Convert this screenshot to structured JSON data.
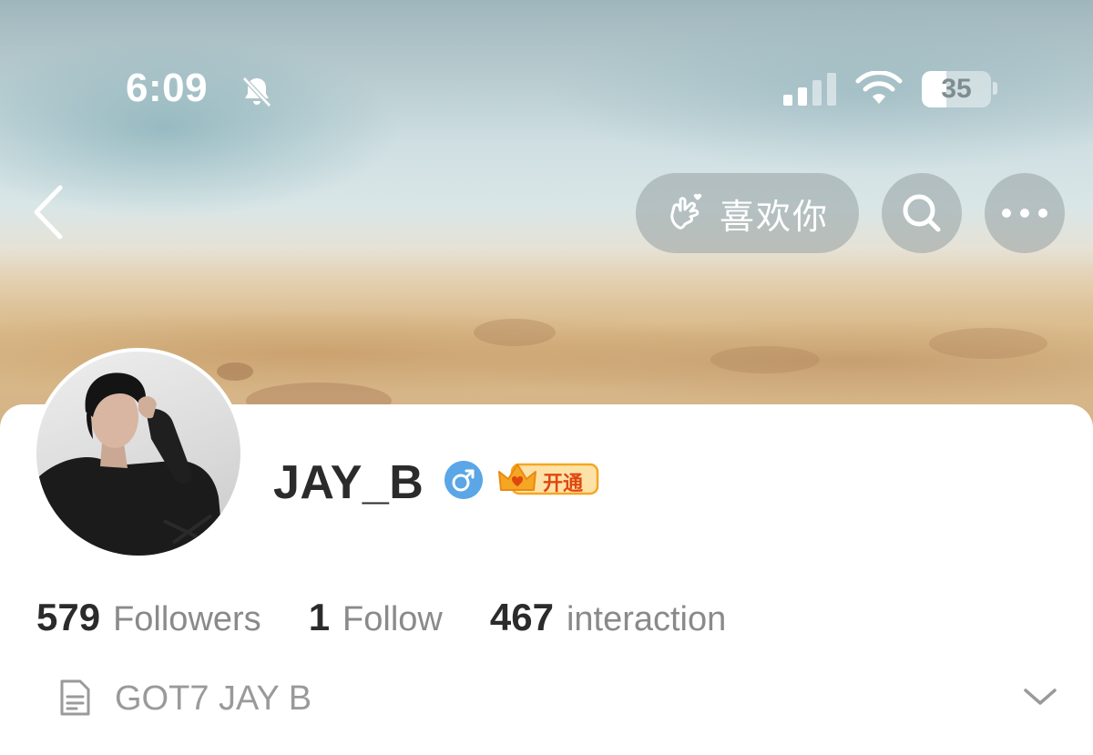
{
  "status_bar": {
    "time": "6:09",
    "battery_level": "35",
    "battery_fraction": 0.35,
    "icons": [
      "bell-slash-icon",
      "cellular-signal-icon",
      "wifi-icon",
      "battery-icon"
    ]
  },
  "nav": {
    "back_icon": "chevron-left-icon",
    "like_button_label": "喜欢你",
    "like_icon": "finger-heart-hand-icon",
    "search_icon": "search-icon",
    "more_icon": "more-horizontal-icon"
  },
  "profile": {
    "username": "JAY_B",
    "gender_icon": "male-symbol-icon",
    "vip_badge_label": "开通",
    "vip_icon": "crown-icon",
    "stats": [
      {
        "value": "579",
        "label": "Followers"
      },
      {
        "value": "1",
        "label": "Follow"
      },
      {
        "value": "467",
        "label": "interaction"
      }
    ],
    "bio_icon": "document-icon",
    "bio": "GOT7 JAY B",
    "expand_icon": "chevron-down-icon"
  },
  "colors": {
    "text_primary": "#2b2b2b",
    "text_secondary": "#8a8a8a",
    "gender_blue": "#5aa6e6",
    "vip_orange": "#f5a623",
    "pill_bg": "rgba(150,160,162,0.55)"
  }
}
